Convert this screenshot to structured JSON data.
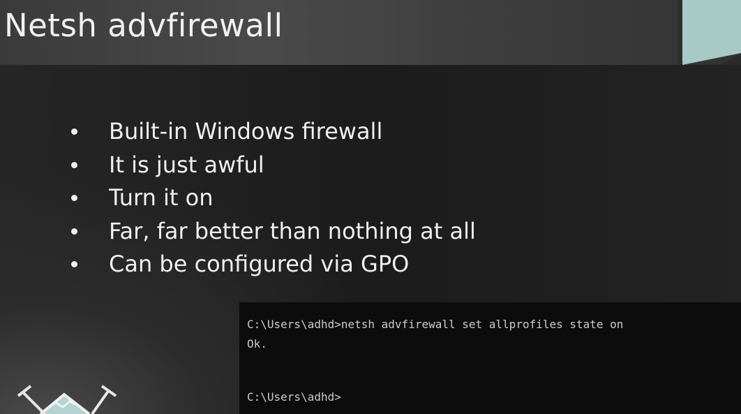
{
  "slide": {
    "title": "Netsh advfirewall",
    "bullets": [
      "Built-in Windows firewall",
      "It is just awful",
      "Turn it on",
      "Far, far better than nothing at all",
      "Can be configured via GPO"
    ]
  },
  "terminal": {
    "lines": [
      "C:\\Users\\adhd>netsh advfirewall set allprofiles state on",
      "Ok.",
      "C:\\Users\\adhd>"
    ]
  },
  "colors": {
    "accent_teal": "#a9c9c6",
    "terminal_background": "#0c0c0c",
    "slide_background": "#1e1e1e",
    "title_bar": "#454545"
  }
}
